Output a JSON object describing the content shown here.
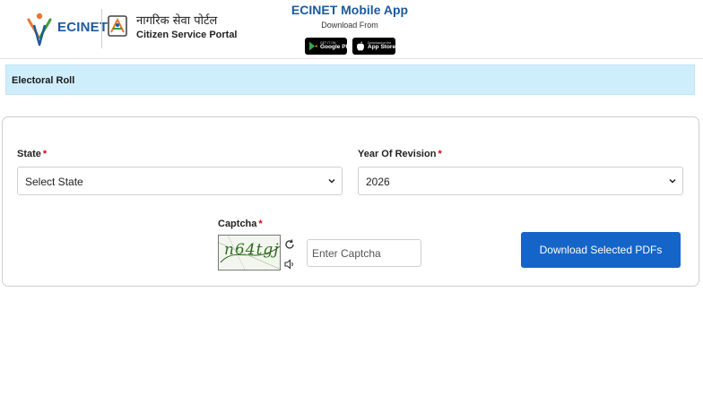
{
  "header": {
    "brand": "ECINET",
    "portal_hindi": "नागरिक सेवा पोर्टल",
    "portal_english": "Citizen Service Portal",
    "app_title": "ECINET Mobile App",
    "app_subtitle": "Download From",
    "google_play": {
      "small": "GET IT ON",
      "big": "Google Play"
    },
    "app_store": {
      "small": "Download on the",
      "big": "App Store"
    }
  },
  "section": {
    "title": "Electoral Roll"
  },
  "form": {
    "state": {
      "label": "State",
      "required_mark": "*",
      "value": "Select State"
    },
    "year": {
      "label": "Year Of Revision",
      "required_mark": "*",
      "value": "2026"
    },
    "captcha": {
      "label": "Captcha",
      "required_mark": "*",
      "image_text": "n64tgj",
      "placeholder": "Enter Captcha"
    },
    "download_button": "Download Selected PDFs"
  },
  "colors": {
    "brand_blue": "#1b5a9c",
    "section_bg": "#cfeefb",
    "button_blue": "#1565c8",
    "required_red": "#d0021b"
  },
  "icons": [
    "ecinet-logo-icon",
    "eci-emblem-icon",
    "google-play-icon",
    "apple-icon",
    "chevron-down-icon",
    "refresh-icon",
    "speaker-icon"
  ]
}
